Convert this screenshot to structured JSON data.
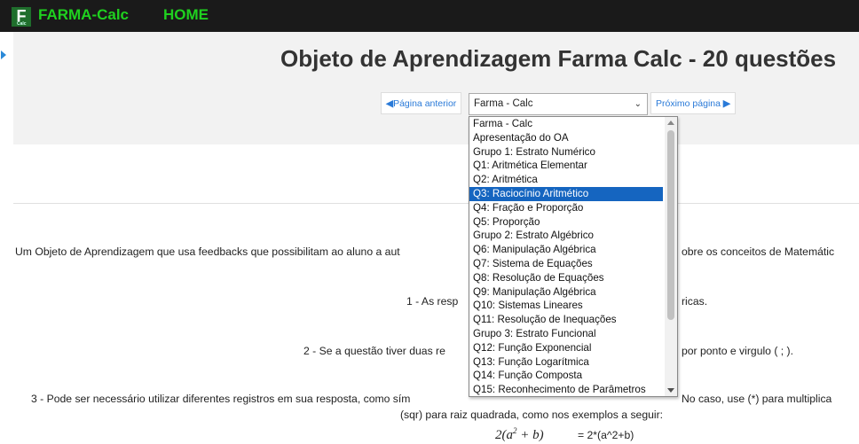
{
  "header": {
    "brand": "FARMA-Calc",
    "home": "HOME",
    "logo_letter": "F",
    "logo_sub": "Calc"
  },
  "page": {
    "title": "Objeto de Aprendizagem Farma Calc - 20 questões"
  },
  "nav": {
    "prev_label": "Página anterior",
    "next_label": "Próximo página",
    "selected": "Farma - Calc"
  },
  "dropdown": {
    "options": [
      "Farma - Calc",
      "Apresentação do OA",
      "Grupo 1: Estrato Numérico",
      "Q1: Aritmética Elementar",
      "Q2: Aritmética",
      "Q3: Raciocínio Aritmético",
      "Q4: Fração e Proporção",
      "Q5: Proporção",
      "Grupo 2: Estrato Algébrico",
      "Q6: Manipulação Algébrica",
      "Q7: Sistema de Equações",
      "Q8: Resolução de Equações",
      "Q9: Manipulação Algébrica",
      "Q10: Sistemas Lineares",
      "Q11: Resolução de Inequações",
      "Grupo 3: Estrato Funcional",
      "Q12: Função Exponencial",
      "Q13: Função Logarítmica",
      "Q14: Função Composta",
      "Q15: Reconhecimento de Parâmetros"
    ],
    "highlighted_index": 5,
    "highlight_color": "#1565c0"
  },
  "content": {
    "heading_fragment": "(",
    "intro_left": "Um Objeto de Aprendizagem que usa feedbacks que possibilitam ao aluno a aut",
    "intro_right": "obre os conceitos de Matemátic",
    "rule1_left": "1 - As resp",
    "rule1_right": "ricas.",
    "rule2_left": "2 - Se a questão tiver duas re",
    "rule2_right": "por ponto e virgulo ( ; ).",
    "rule3_left": "3 - Pode ser necessário utilizar diferentes registros em sua resposta, como sím",
    "rule3_right": "No caso, use (*) para multiplica",
    "rule3_line2": "(sqr) para raiz quadrada, como nos exemplos a seguir:",
    "formula_plain": "= 2*(a^2+b)"
  },
  "colors": {
    "brand_green": "#1fd11f",
    "topbar": "#1a1a1a",
    "link_blue": "#2a7ad8"
  }
}
